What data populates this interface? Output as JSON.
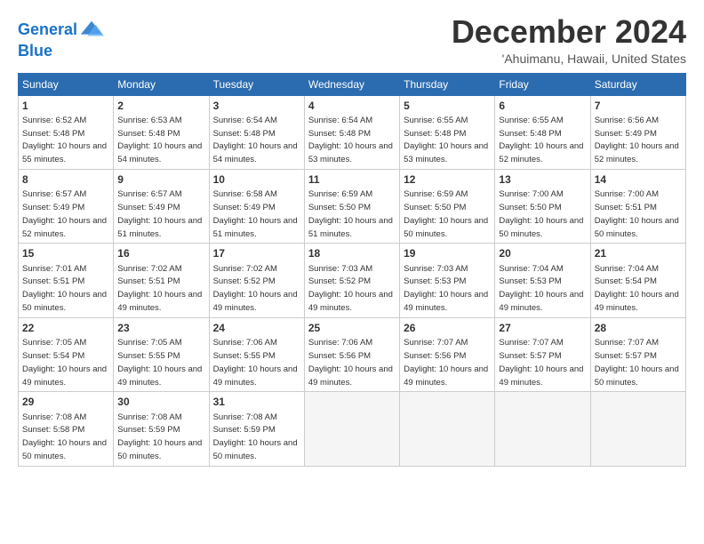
{
  "logo": {
    "line1": "General",
    "line2": "Blue"
  },
  "title": "December 2024",
  "subtitle": "'Ahuimanu, Hawaii, United States",
  "weekdays": [
    "Sunday",
    "Monday",
    "Tuesday",
    "Wednesday",
    "Thursday",
    "Friday",
    "Saturday"
  ],
  "weeks": [
    [
      {
        "day": 1,
        "sunrise": "6:52 AM",
        "sunset": "5:48 PM",
        "daylight": "10 hours and 55 minutes."
      },
      {
        "day": 2,
        "sunrise": "6:53 AM",
        "sunset": "5:48 PM",
        "daylight": "10 hours and 54 minutes."
      },
      {
        "day": 3,
        "sunrise": "6:54 AM",
        "sunset": "5:48 PM",
        "daylight": "10 hours and 54 minutes."
      },
      {
        "day": 4,
        "sunrise": "6:54 AM",
        "sunset": "5:48 PM",
        "daylight": "10 hours and 53 minutes."
      },
      {
        "day": 5,
        "sunrise": "6:55 AM",
        "sunset": "5:48 PM",
        "daylight": "10 hours and 53 minutes."
      },
      {
        "day": 6,
        "sunrise": "6:55 AM",
        "sunset": "5:48 PM",
        "daylight": "10 hours and 52 minutes."
      },
      {
        "day": 7,
        "sunrise": "6:56 AM",
        "sunset": "5:49 PM",
        "daylight": "10 hours and 52 minutes."
      }
    ],
    [
      {
        "day": 8,
        "sunrise": "6:57 AM",
        "sunset": "5:49 PM",
        "daylight": "10 hours and 52 minutes."
      },
      {
        "day": 9,
        "sunrise": "6:57 AM",
        "sunset": "5:49 PM",
        "daylight": "10 hours and 51 minutes."
      },
      {
        "day": 10,
        "sunrise": "6:58 AM",
        "sunset": "5:49 PM",
        "daylight": "10 hours and 51 minutes."
      },
      {
        "day": 11,
        "sunrise": "6:59 AM",
        "sunset": "5:50 PM",
        "daylight": "10 hours and 51 minutes."
      },
      {
        "day": 12,
        "sunrise": "6:59 AM",
        "sunset": "5:50 PM",
        "daylight": "10 hours and 50 minutes."
      },
      {
        "day": 13,
        "sunrise": "7:00 AM",
        "sunset": "5:50 PM",
        "daylight": "10 hours and 50 minutes."
      },
      {
        "day": 14,
        "sunrise": "7:00 AM",
        "sunset": "5:51 PM",
        "daylight": "10 hours and 50 minutes."
      }
    ],
    [
      {
        "day": 15,
        "sunrise": "7:01 AM",
        "sunset": "5:51 PM",
        "daylight": "10 hours and 50 minutes."
      },
      {
        "day": 16,
        "sunrise": "7:02 AM",
        "sunset": "5:51 PM",
        "daylight": "10 hours and 49 minutes."
      },
      {
        "day": 17,
        "sunrise": "7:02 AM",
        "sunset": "5:52 PM",
        "daylight": "10 hours and 49 minutes."
      },
      {
        "day": 18,
        "sunrise": "7:03 AM",
        "sunset": "5:52 PM",
        "daylight": "10 hours and 49 minutes."
      },
      {
        "day": 19,
        "sunrise": "7:03 AM",
        "sunset": "5:53 PM",
        "daylight": "10 hours and 49 minutes."
      },
      {
        "day": 20,
        "sunrise": "7:04 AM",
        "sunset": "5:53 PM",
        "daylight": "10 hours and 49 minutes."
      },
      {
        "day": 21,
        "sunrise": "7:04 AM",
        "sunset": "5:54 PM",
        "daylight": "10 hours and 49 minutes."
      }
    ],
    [
      {
        "day": 22,
        "sunrise": "7:05 AM",
        "sunset": "5:54 PM",
        "daylight": "10 hours and 49 minutes."
      },
      {
        "day": 23,
        "sunrise": "7:05 AM",
        "sunset": "5:55 PM",
        "daylight": "10 hours and 49 minutes."
      },
      {
        "day": 24,
        "sunrise": "7:06 AM",
        "sunset": "5:55 PM",
        "daylight": "10 hours and 49 minutes."
      },
      {
        "day": 25,
        "sunrise": "7:06 AM",
        "sunset": "5:56 PM",
        "daylight": "10 hours and 49 minutes."
      },
      {
        "day": 26,
        "sunrise": "7:07 AM",
        "sunset": "5:56 PM",
        "daylight": "10 hours and 49 minutes."
      },
      {
        "day": 27,
        "sunrise": "7:07 AM",
        "sunset": "5:57 PM",
        "daylight": "10 hours and 49 minutes."
      },
      {
        "day": 28,
        "sunrise": "7:07 AM",
        "sunset": "5:57 PM",
        "daylight": "10 hours and 50 minutes."
      }
    ],
    [
      {
        "day": 29,
        "sunrise": "7:08 AM",
        "sunset": "5:58 PM",
        "daylight": "10 hours and 50 minutes."
      },
      {
        "day": 30,
        "sunrise": "7:08 AM",
        "sunset": "5:59 PM",
        "daylight": "10 hours and 50 minutes."
      },
      {
        "day": 31,
        "sunrise": "7:08 AM",
        "sunset": "5:59 PM",
        "daylight": "10 hours and 50 minutes."
      },
      null,
      null,
      null,
      null
    ]
  ]
}
